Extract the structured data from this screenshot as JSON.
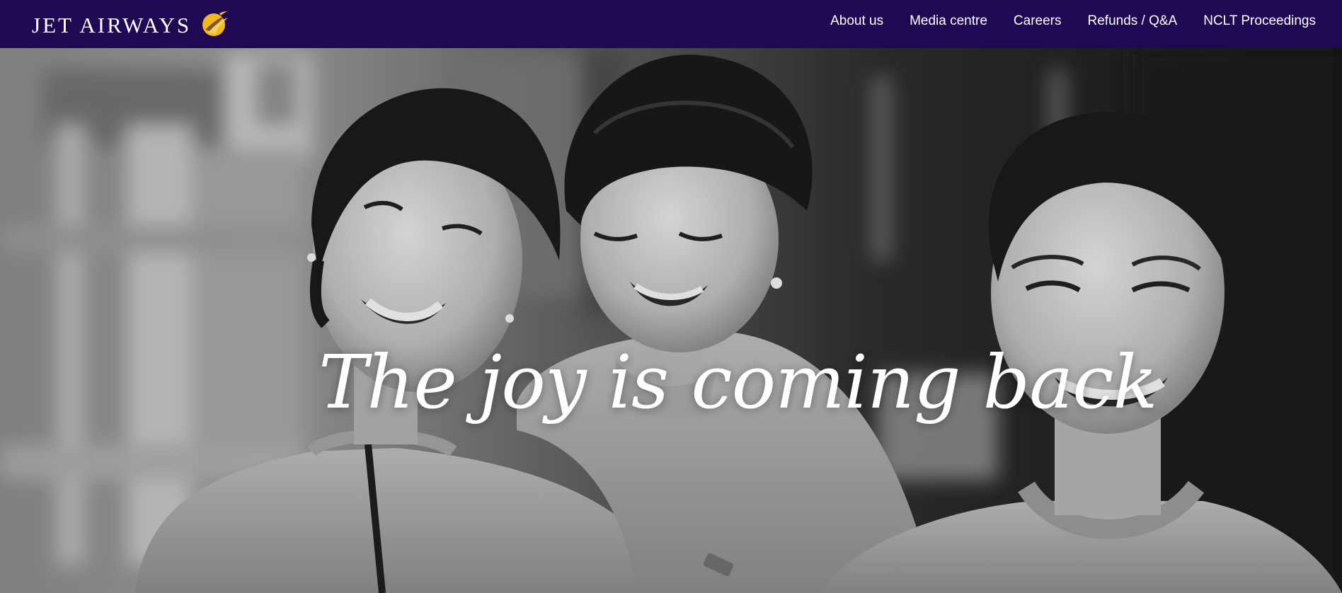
{
  "header": {
    "brand_name": "JET AIRWAYS",
    "logo_icon": "jet-airways-swallow-logo-icon",
    "background_color": "#1f0854",
    "logo_color": "#f2b81c",
    "nav": [
      {
        "label": "About us"
      },
      {
        "label": "Media centre"
      },
      {
        "label": "Careers"
      },
      {
        "label": "Refunds / Q&A"
      },
      {
        "label": "NCLT Proceedings"
      }
    ]
  },
  "hero": {
    "headline": "The joy is coming back",
    "image_description_icon": "cabin-crew-photo",
    "tone": "black-and-white"
  }
}
